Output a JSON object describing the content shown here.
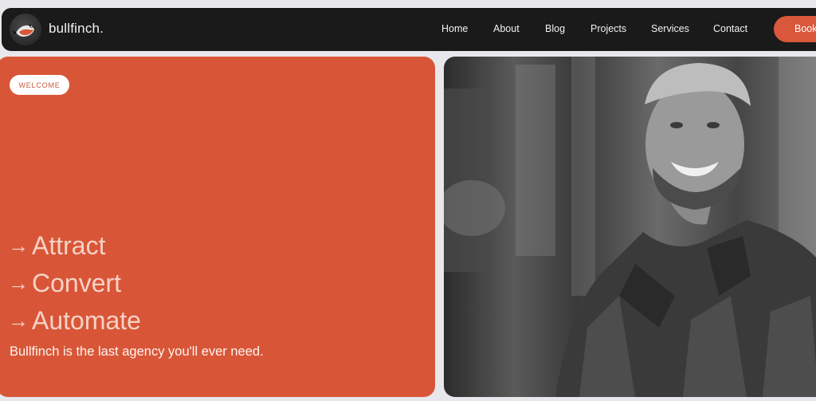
{
  "brand": {
    "name": "bullfinch."
  },
  "nav": {
    "links": [
      "Home",
      "About",
      "Blog",
      "Projects",
      "Services",
      "Contact"
    ],
    "cta_label": "Book"
  },
  "hero": {
    "badge": "WELCOME",
    "lines": [
      "Attract",
      "Convert",
      "Automate"
    ],
    "tagline": "Bullfinch is the last agency you'll ever need.",
    "accent_color": "#d85637"
  },
  "colors": {
    "nav_bg": "#1a1a1a",
    "button": "#d9573a"
  },
  "icons": {
    "logo": "bullfinch-bird-icon",
    "arrow": "arrow-right-icon"
  }
}
